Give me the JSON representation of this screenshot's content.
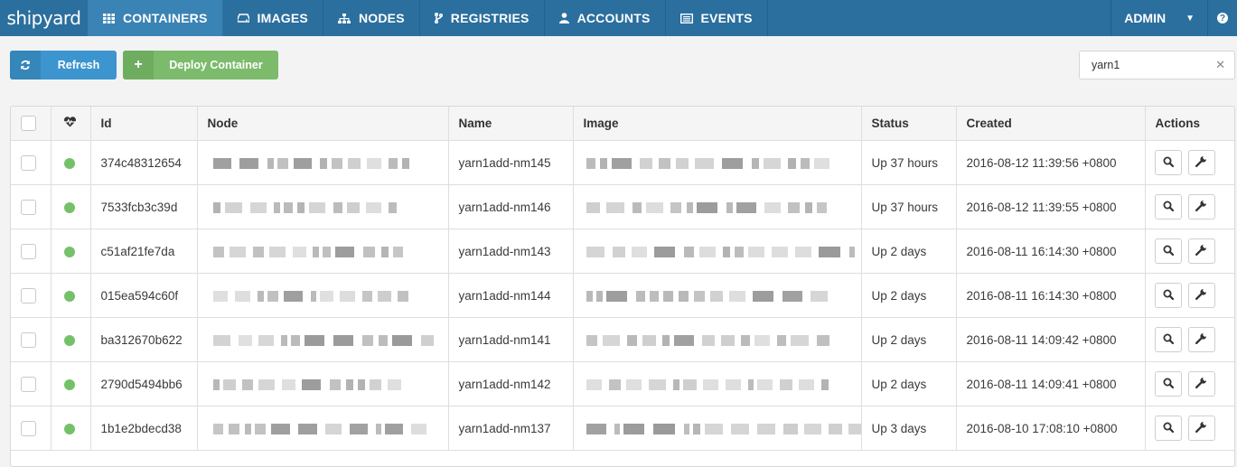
{
  "app": {
    "logo": "shipyard"
  },
  "nav": {
    "items": [
      {
        "label": "CONTAINERS",
        "icon": "grid-icon",
        "active": true
      },
      {
        "label": "IMAGES",
        "icon": "drive-icon",
        "active": false
      },
      {
        "label": "NODES",
        "icon": "sitemap-icon",
        "active": false
      },
      {
        "label": "REGISTRIES",
        "icon": "branch-icon",
        "active": false
      },
      {
        "label": "ACCOUNTS",
        "icon": "user-icon",
        "active": false
      },
      {
        "label": "EVENTS",
        "icon": "list-icon",
        "active": false
      }
    ],
    "user": "ADMIN",
    "help": "?"
  },
  "toolbar": {
    "refresh_label": "Refresh",
    "deploy_label": "Deploy Container"
  },
  "search": {
    "value": "yarn1",
    "clear": "✕"
  },
  "table": {
    "columns": [
      "",
      "",
      "Id",
      "Node",
      "Name",
      "Image",
      "Status",
      "Created",
      "Actions"
    ],
    "rows": [
      {
        "id": "374c48312654",
        "name": "yarn1add-nm145",
        "status": "Up 37 hours",
        "created": "2016-08-12 11:39:56 +0800"
      },
      {
        "id": "7533fcb3c39d",
        "name": "yarn1add-nm146",
        "status": "Up 37 hours",
        "created": "2016-08-12 11:39:55 +0800"
      },
      {
        "id": "c51af21fe7da",
        "name": "yarn1add-nm143",
        "status": "Up 2 days",
        "created": "2016-08-11 16:14:30 +0800"
      },
      {
        "id": "015ea594c60f",
        "name": "yarn1add-nm144",
        "status": "Up 2 days",
        "created": "2016-08-11 16:14:30 +0800"
      },
      {
        "id": "ba312670b622",
        "name": "yarn1add-nm141",
        "status": "Up 2 days",
        "created": "2016-08-11 14:09:42 +0800"
      },
      {
        "id": "2790d5494bb6",
        "name": "yarn1add-nm142",
        "status": "Up 2 days",
        "created": "2016-08-11 14:09:41 +0800"
      },
      {
        "id": "1b1e2bdecd38",
        "name": "yarn1add-nm137",
        "status": "Up 3 days",
        "created": "2016-08-10 17:08:10 +0800"
      }
    ]
  },
  "colors": {
    "navbar": "#2b6f9e",
    "nav_active": "#3a83b5",
    "refresh": "#3c95ce",
    "deploy": "#7cbb6c",
    "status_up": "#75c16a"
  }
}
